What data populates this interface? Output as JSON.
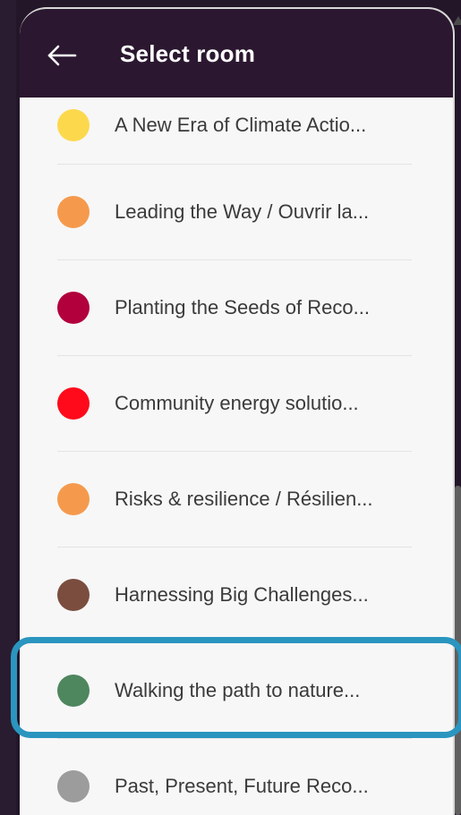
{
  "header": {
    "title": "Select room",
    "back_icon": "arrow-left-icon"
  },
  "rooms": [
    {
      "label": "A New Era of Climate Actio...",
      "color": "#fcd94c"
    },
    {
      "label": "Leading the Way / Ouvrir la...",
      "color": "#f59a4d"
    },
    {
      "label": "Planting the Seeds of Reco...",
      "color": "#b2003c"
    },
    {
      "label": "Community energy solutio...",
      "color": "#ff0a1a"
    },
    {
      "label": "Risks & resilience / Résilien...",
      "color": "#f59a4d"
    },
    {
      "label": "Harnessing Big Challenges...",
      "color": "#7a4d3f"
    },
    {
      "label": "Walking the path to nature...",
      "color": "#4e865e"
    },
    {
      "label": "Past, Present, Future Reco...",
      "color": "#9c9c9c"
    }
  ],
  "highlight_color": "#2a95bf",
  "highlighted_room_index": 6
}
